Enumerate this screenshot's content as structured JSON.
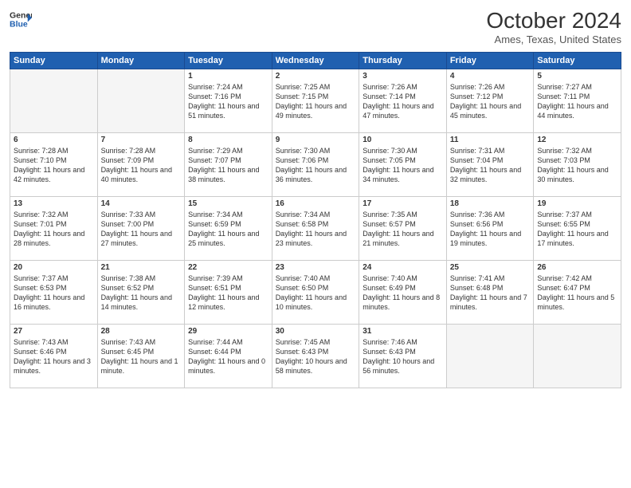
{
  "logo": {
    "line1": "General",
    "line2": "Blue"
  },
  "title": "October 2024",
  "location": "Ames, Texas, United States",
  "days_of_week": [
    "Sunday",
    "Monday",
    "Tuesday",
    "Wednesday",
    "Thursday",
    "Friday",
    "Saturday"
  ],
  "weeks": [
    [
      {
        "day": "",
        "content": ""
      },
      {
        "day": "",
        "content": ""
      },
      {
        "day": "1",
        "content": "Sunrise: 7:24 AM\nSunset: 7:16 PM\nDaylight: 11 hours and 51 minutes."
      },
      {
        "day": "2",
        "content": "Sunrise: 7:25 AM\nSunset: 7:15 PM\nDaylight: 11 hours and 49 minutes."
      },
      {
        "day": "3",
        "content": "Sunrise: 7:26 AM\nSunset: 7:14 PM\nDaylight: 11 hours and 47 minutes."
      },
      {
        "day": "4",
        "content": "Sunrise: 7:26 AM\nSunset: 7:12 PM\nDaylight: 11 hours and 45 minutes."
      },
      {
        "day": "5",
        "content": "Sunrise: 7:27 AM\nSunset: 7:11 PM\nDaylight: 11 hours and 44 minutes."
      }
    ],
    [
      {
        "day": "6",
        "content": "Sunrise: 7:28 AM\nSunset: 7:10 PM\nDaylight: 11 hours and 42 minutes."
      },
      {
        "day": "7",
        "content": "Sunrise: 7:28 AM\nSunset: 7:09 PM\nDaylight: 11 hours and 40 minutes."
      },
      {
        "day": "8",
        "content": "Sunrise: 7:29 AM\nSunset: 7:07 PM\nDaylight: 11 hours and 38 minutes."
      },
      {
        "day": "9",
        "content": "Sunrise: 7:30 AM\nSunset: 7:06 PM\nDaylight: 11 hours and 36 minutes."
      },
      {
        "day": "10",
        "content": "Sunrise: 7:30 AM\nSunset: 7:05 PM\nDaylight: 11 hours and 34 minutes."
      },
      {
        "day": "11",
        "content": "Sunrise: 7:31 AM\nSunset: 7:04 PM\nDaylight: 11 hours and 32 minutes."
      },
      {
        "day": "12",
        "content": "Sunrise: 7:32 AM\nSunset: 7:03 PM\nDaylight: 11 hours and 30 minutes."
      }
    ],
    [
      {
        "day": "13",
        "content": "Sunrise: 7:32 AM\nSunset: 7:01 PM\nDaylight: 11 hours and 28 minutes."
      },
      {
        "day": "14",
        "content": "Sunrise: 7:33 AM\nSunset: 7:00 PM\nDaylight: 11 hours and 27 minutes."
      },
      {
        "day": "15",
        "content": "Sunrise: 7:34 AM\nSunset: 6:59 PM\nDaylight: 11 hours and 25 minutes."
      },
      {
        "day": "16",
        "content": "Sunrise: 7:34 AM\nSunset: 6:58 PM\nDaylight: 11 hours and 23 minutes."
      },
      {
        "day": "17",
        "content": "Sunrise: 7:35 AM\nSunset: 6:57 PM\nDaylight: 11 hours and 21 minutes."
      },
      {
        "day": "18",
        "content": "Sunrise: 7:36 AM\nSunset: 6:56 PM\nDaylight: 11 hours and 19 minutes."
      },
      {
        "day": "19",
        "content": "Sunrise: 7:37 AM\nSunset: 6:55 PM\nDaylight: 11 hours and 17 minutes."
      }
    ],
    [
      {
        "day": "20",
        "content": "Sunrise: 7:37 AM\nSunset: 6:53 PM\nDaylight: 11 hours and 16 minutes."
      },
      {
        "day": "21",
        "content": "Sunrise: 7:38 AM\nSunset: 6:52 PM\nDaylight: 11 hours and 14 minutes."
      },
      {
        "day": "22",
        "content": "Sunrise: 7:39 AM\nSunset: 6:51 PM\nDaylight: 11 hours and 12 minutes."
      },
      {
        "day": "23",
        "content": "Sunrise: 7:40 AM\nSunset: 6:50 PM\nDaylight: 11 hours and 10 minutes."
      },
      {
        "day": "24",
        "content": "Sunrise: 7:40 AM\nSunset: 6:49 PM\nDaylight: 11 hours and 8 minutes."
      },
      {
        "day": "25",
        "content": "Sunrise: 7:41 AM\nSunset: 6:48 PM\nDaylight: 11 hours and 7 minutes."
      },
      {
        "day": "26",
        "content": "Sunrise: 7:42 AM\nSunset: 6:47 PM\nDaylight: 11 hours and 5 minutes."
      }
    ],
    [
      {
        "day": "27",
        "content": "Sunrise: 7:43 AM\nSunset: 6:46 PM\nDaylight: 11 hours and 3 minutes."
      },
      {
        "day": "28",
        "content": "Sunrise: 7:43 AM\nSunset: 6:45 PM\nDaylight: 11 hours and 1 minute."
      },
      {
        "day": "29",
        "content": "Sunrise: 7:44 AM\nSunset: 6:44 PM\nDaylight: 11 hours and 0 minutes."
      },
      {
        "day": "30",
        "content": "Sunrise: 7:45 AM\nSunset: 6:43 PM\nDaylight: 10 hours and 58 minutes."
      },
      {
        "day": "31",
        "content": "Sunrise: 7:46 AM\nSunset: 6:43 PM\nDaylight: 10 hours and 56 minutes."
      },
      {
        "day": "",
        "content": ""
      },
      {
        "day": "",
        "content": ""
      }
    ]
  ]
}
